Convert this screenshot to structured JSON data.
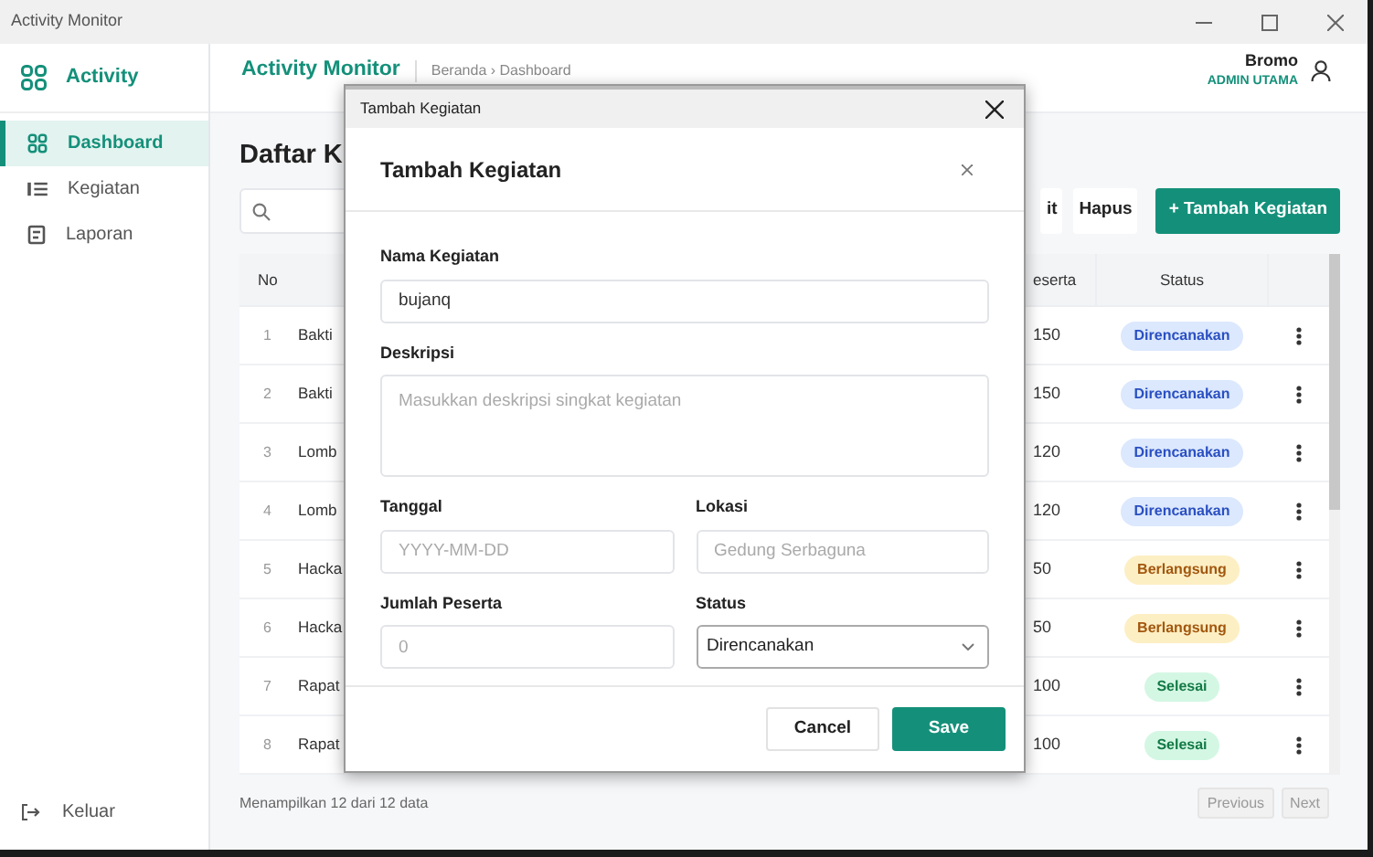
{
  "window": {
    "title": "Activity Monitor"
  },
  "sidebar": {
    "brand": "Activity",
    "items": [
      {
        "label": "Dashboard",
        "selected": true
      },
      {
        "label": "Kegiatan",
        "selected": false
      },
      {
        "label": "Laporan",
        "selected": false
      }
    ],
    "logout": "Keluar"
  },
  "header": {
    "title": "Activity Monitor",
    "breadcrumb": {
      "items": [
        "Beranda",
        "Dashboard"
      ],
      "separator": "›"
    },
    "user": {
      "name": "Bromo",
      "role": "ADMIN UTAMA"
    }
  },
  "page": {
    "title": "Daftar K",
    "buttons": [
      {
        "label": "it",
        "kind": "plain"
      },
      {
        "label": "Hapus",
        "kind": "plain"
      },
      {
        "label": "+ Tambah Kegiatan",
        "kind": "primary"
      }
    ]
  },
  "table": {
    "columns": [
      "No",
      "eserta",
      "Status"
    ],
    "rows": [
      {
        "no": "1",
        "name": "Bakti",
        "peserta": "150",
        "status": "Direncanakan",
        "kind": "planned"
      },
      {
        "no": "2",
        "name": "Bakti",
        "peserta": "150",
        "status": "Direncanakan",
        "kind": "planned"
      },
      {
        "no": "3",
        "name": "Lomb",
        "peserta": "120",
        "status": "Direncanakan",
        "kind": "planned"
      },
      {
        "no": "4",
        "name": "Lomb",
        "peserta": "120",
        "status": "Direncanakan",
        "kind": "planned"
      },
      {
        "no": "5",
        "name": "Hacka",
        "peserta": "50",
        "status": "Berlangsung",
        "kind": "ongoing"
      },
      {
        "no": "6",
        "name": "Hacka",
        "peserta": "50",
        "status": "Berlangsung",
        "kind": "ongoing"
      },
      {
        "no": "7",
        "name": "Rapat",
        "peserta": "100",
        "status": "Selesai",
        "kind": "done"
      },
      {
        "no": "8",
        "name": "Rapat",
        "peserta": "100",
        "status": "Selesai",
        "kind": "done"
      }
    ]
  },
  "footer": {
    "summary": "Menampilkan 12 dari 12 data",
    "pagination": [
      {
        "label": "Previous",
        "disabled": true
      },
      {
        "label": "Next",
        "disabled": true
      }
    ]
  },
  "dialog": {
    "window_title": "Tambah Kegiatan",
    "title": "Tambah Kegiatan",
    "fields": {
      "name": {
        "label": "Nama Kegiatan",
        "value": "bujanq"
      },
      "description": {
        "label": "Deskripsi",
        "placeholder": "Masukkan deskripsi singkat kegiatan"
      },
      "date": {
        "label": "Tanggal",
        "placeholder": "YYYY-MM-DD"
      },
      "location": {
        "label": "Lokasi",
        "placeholder": "Gedung Serbaguna"
      },
      "participants": {
        "label": "Jumlah Peserta",
        "placeholder": "0"
      },
      "status": {
        "label": "Status",
        "value": "Direncanakan"
      }
    },
    "buttons": [
      {
        "label": "Cancel",
        "kind": "plain"
      },
      {
        "label": "Save",
        "kind": "primary"
      }
    ]
  }
}
